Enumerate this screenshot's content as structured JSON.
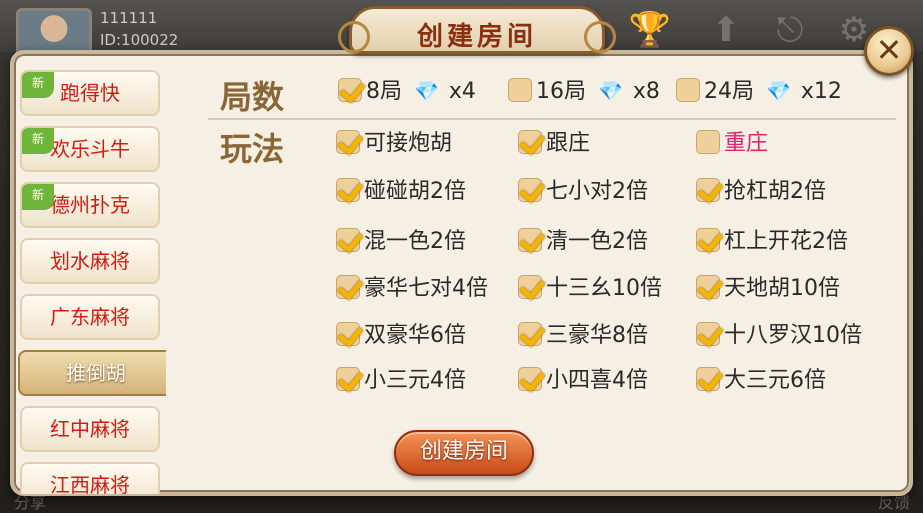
{
  "user": {
    "name": "111111",
    "id": "ID:100022"
  },
  "title": "创建房间",
  "bottom_bar": {
    "left_label": "分享",
    "right_label": "反馈"
  },
  "sidebar": {
    "items": [
      {
        "label": "跑得快",
        "is_new": true,
        "new_label": "新"
      },
      {
        "label": "欢乐斗牛",
        "is_new": true,
        "new_label": "新"
      },
      {
        "label": "德州扑克",
        "is_new": true,
        "new_label": "新"
      },
      {
        "label": "划水麻将",
        "is_new": false
      },
      {
        "label": "广东麻将",
        "is_new": false
      },
      {
        "label": "推倒胡",
        "is_new": false,
        "active": true
      },
      {
        "label": "红中麻将",
        "is_new": false
      },
      {
        "label": "江西麻将",
        "is_new": false
      }
    ]
  },
  "rounds": {
    "label": "局数",
    "options": [
      {
        "label": "8局",
        "cost": "x4",
        "checked": true
      },
      {
        "label": "16局",
        "cost": "x8",
        "checked": false
      },
      {
        "label": "24局",
        "cost": "x12",
        "checked": false
      }
    ]
  },
  "play": {
    "label": "玩法",
    "options": [
      {
        "label": "可接炮胡",
        "checked": true
      },
      {
        "label": "跟庄",
        "checked": true
      },
      {
        "label": "重庄",
        "checked": false,
        "highlight": true
      },
      {
        "label": "碰碰胡2倍",
        "checked": true
      },
      {
        "label": "七小对2倍",
        "checked": true
      },
      {
        "label": "抢杠胡2倍",
        "checked": true
      },
      {
        "label": "混一色2倍",
        "checked": true
      },
      {
        "label": "清一色2倍",
        "checked": true
      },
      {
        "label": "杠上开花2倍",
        "checked": true
      },
      {
        "label": "豪华七对4倍",
        "checked": true
      },
      {
        "label": "十三幺10倍",
        "checked": true
      },
      {
        "label": "天地胡10倍",
        "checked": true
      },
      {
        "label": "双豪华6倍",
        "checked": true
      },
      {
        "label": "三豪华8倍",
        "checked": true
      },
      {
        "label": "十八罗汉10倍",
        "checked": true
      },
      {
        "label": "小三元4倍",
        "checked": true
      },
      {
        "label": "小四喜4倍",
        "checked": true
      },
      {
        "label": "大三元6倍",
        "checked": true
      }
    ]
  },
  "create_button": {
    "label": "创建房间"
  },
  "icons": {
    "gem": "diamond-icon",
    "close": "close-icon",
    "check": "check-icon"
  },
  "colors": {
    "accent": "#d84f1c",
    "sidebar_text": "#d51a12",
    "highlight": "#e8206d"
  }
}
